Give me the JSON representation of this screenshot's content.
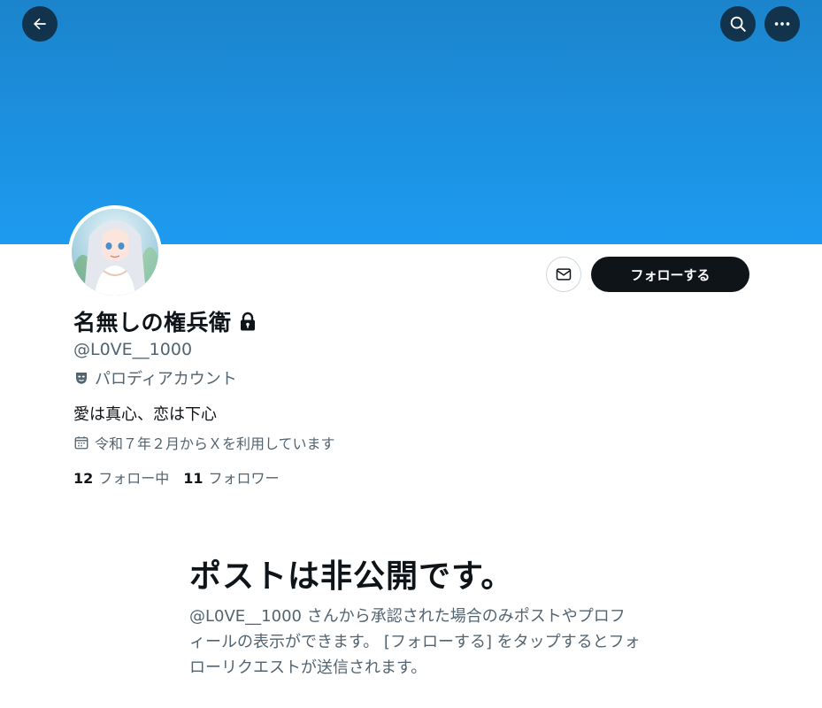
{
  "header": {
    "back_icon": "arrow-left-icon",
    "search_icon": "search-icon",
    "more_icon": "more-horizontal-icon",
    "banner_color": "#1d9bf0"
  },
  "profile": {
    "display_name": "名無しの権兵衛",
    "protected_icon": "lock-icon",
    "handle": "@L0VE__1000",
    "parody_label": "パロディアカウント",
    "bio": "愛は真心、恋は下心",
    "joined": "令和７年２月からＸを利用しています",
    "following_count": "12",
    "following_label": "フォロー中",
    "followers_count": "11",
    "followers_label": "フォロワー"
  },
  "actions": {
    "message_icon": "envelope-icon",
    "follow_label": "フォローする"
  },
  "private_notice": {
    "title": "ポストは非公開です。",
    "description": "@L0VE__1000 さんから承認された場合のみポストやプロフィールの表示ができます。 [フォローする] をタップするとフォローリクエストが送信されます。"
  }
}
